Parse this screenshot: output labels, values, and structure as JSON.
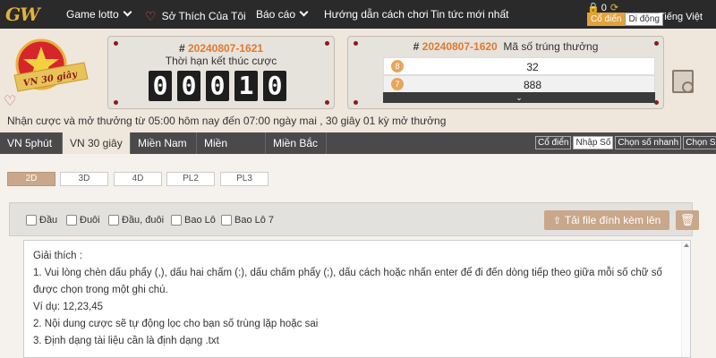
{
  "topbar": {
    "logo": "GW",
    "nav": [
      {
        "label": "Game lotto",
        "has_dropdown": true
      },
      {
        "label": "Sở Thích Của Tôi",
        "has_dropdown": false
      },
      {
        "label": "Báo cáo",
        "has_dropdown": true
      },
      {
        "label": "Hướng dẫn cách chơi",
        "has_dropdown": false
      },
      {
        "label": "Tin tức mới nhất",
        "has_dropdown": false
      }
    ],
    "balance": "0",
    "mode_classic": "Cổ điển",
    "mode_mobile": "Di động",
    "language": "Tiếng Việt"
  },
  "header": {
    "badge_text": "VN 30 giây",
    "current": {
      "hash": "#",
      "period": "20240807-1621",
      "label": "Thời hạn kết thúc cược",
      "digits": [
        "0",
        "0",
        "0",
        "1",
        "0"
      ]
    },
    "results": {
      "hash": "#",
      "period": "20240807-1620",
      "label": "Mã số trúng thưởng",
      "rows": [
        {
          "ball": "8",
          "value": "32"
        },
        {
          "ball": "7",
          "value": "888"
        }
      ]
    },
    "info": "Nhận cược và mở thưởng từ 05:00 hôm nay đến 07:00 ngày mai ,  30 giây 01 kỳ mở thưởng"
  },
  "tabs": {
    "items": [
      "VN 5phút",
      "VN 30 giây",
      "Miền Nam",
      "Miền Trung",
      "Miền Bắc"
    ],
    "active": "VN 30 giây",
    "tools": [
      "Cổ điển",
      "Nhập Số",
      "Chọn số nhanh",
      "Chọn Số"
    ],
    "active_tool": "Nhập Số"
  },
  "subtabs": {
    "items": [
      "2D",
      "3D",
      "4D",
      "PL2",
      "PL3"
    ],
    "active": "2D"
  },
  "options": {
    "checkboxes": [
      "Đầu",
      "Đuôi",
      "Đầu, đuôi",
      "Bao Lô",
      "Bao Lô 7"
    ],
    "upload_label": "Tải file đính kèm lên"
  },
  "instructions": {
    "title": "Giải thích :",
    "lines": [
      "1. Vui lòng chèn dấu phẩy (,), dấu hai chấm (:), dấu chấm phẩy (;), dấu cách hoặc nhấn enter để đi đến dòng tiếp theo giữa mỗi số chữ số",
      "được chọn trong một ghi chú.",
      "Ví dụ: 12,23,45",
      "2. Nội dung cược sẽ tự động lọc cho bạn số trùng lặp hoặc sai",
      "3. Định dạng tài liệu cần là định dạng .txt"
    ]
  },
  "colors": {
    "accent": "#c8a78a",
    "period_orange": "#e07a2e",
    "topbar": "#2a2a2a",
    "tabbar": "#4a4a4a"
  }
}
